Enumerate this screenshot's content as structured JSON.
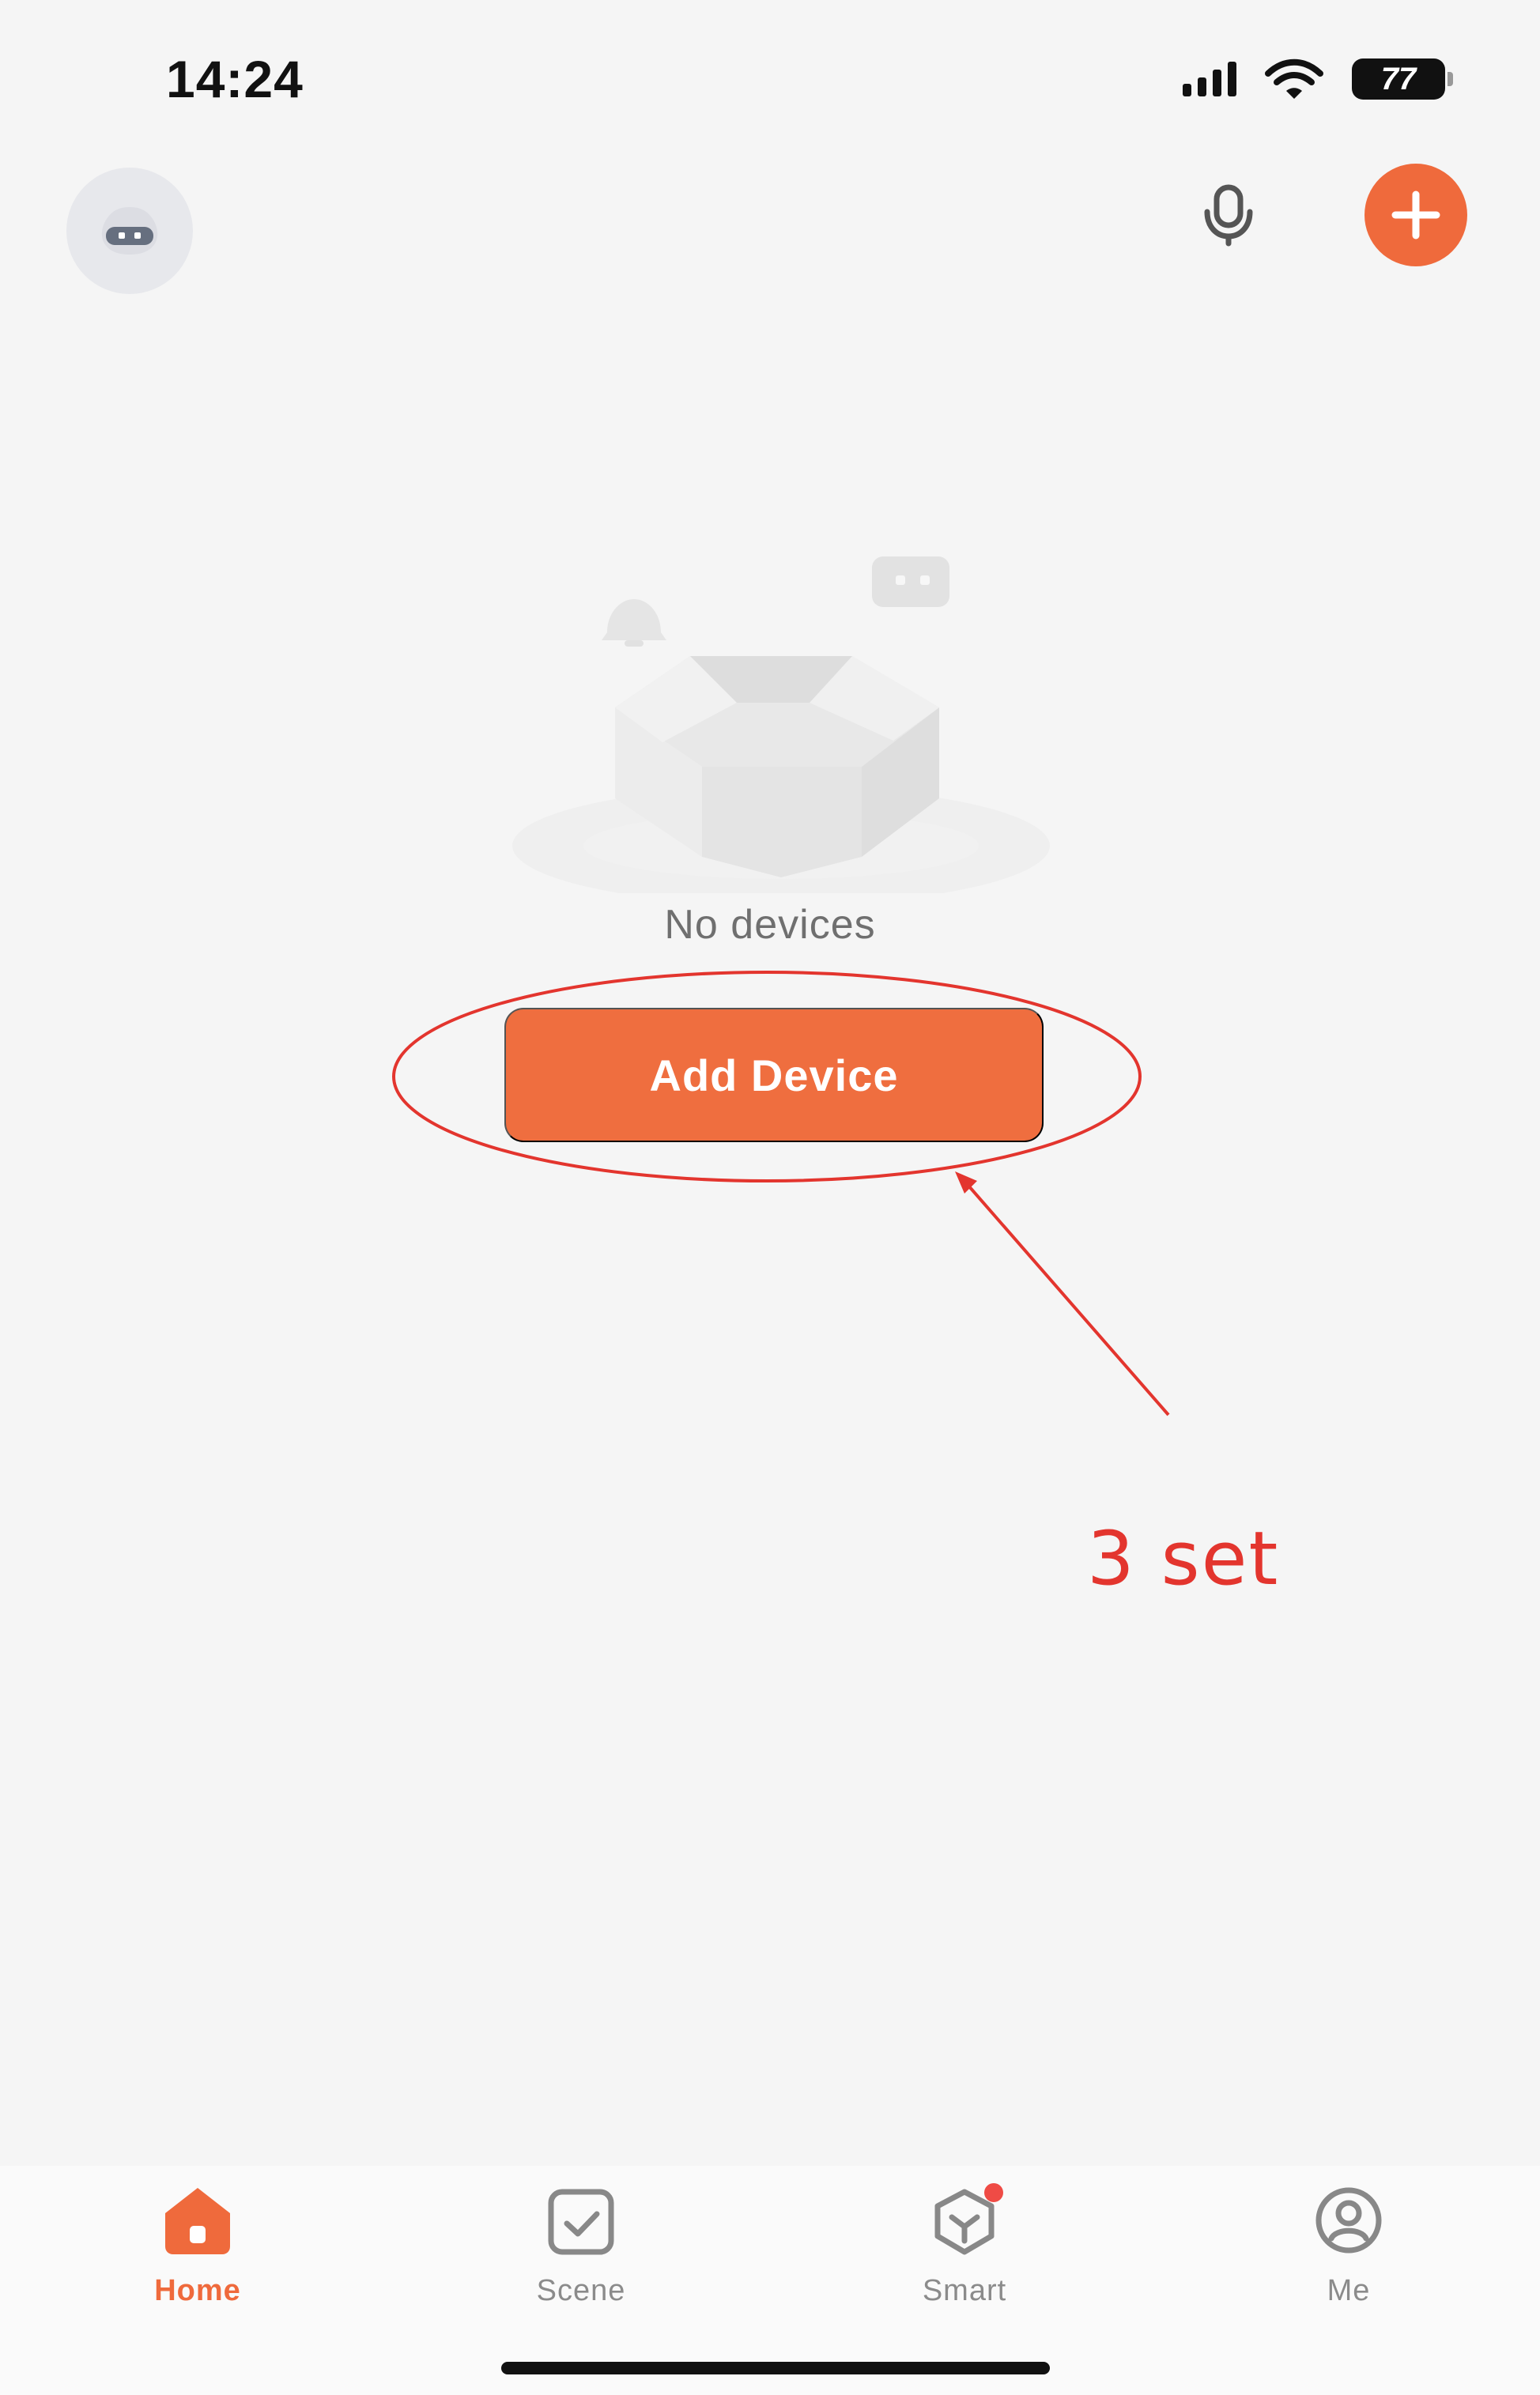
{
  "status_bar": {
    "time": "14:24",
    "battery": "77"
  },
  "top_bar": {
    "avatar_icon": "avatar-icon",
    "mic_icon": "microphone-icon",
    "add_icon": "plus-icon"
  },
  "main": {
    "empty_text": "No devices",
    "add_device_label": "Add Device",
    "annotation_text": "3 set"
  },
  "bottom_nav": {
    "items": [
      {
        "label": "Home",
        "icon": "home-icon"
      },
      {
        "label": "Scene",
        "icon": "scene-icon"
      },
      {
        "label": "Smart",
        "icon": "smart-icon"
      },
      {
        "label": "Me",
        "icon": "profile-icon"
      }
    ]
  },
  "colors": {
    "accent": "#ef6a3c",
    "annotation": "#e3352e",
    "background": "#f5f5f5"
  }
}
